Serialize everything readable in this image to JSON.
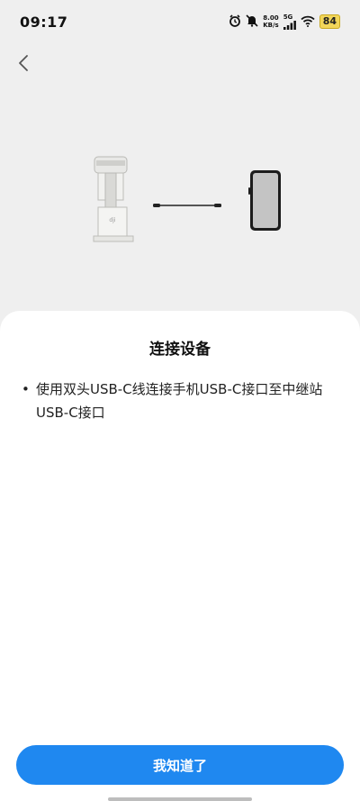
{
  "status": {
    "time": "09:17",
    "net_speed_value": "8.00",
    "net_speed_unit": "KB/s",
    "network_type": "5G",
    "battery": "84"
  },
  "sheet": {
    "title": "连接设备",
    "bullet_text": "使用双头USB-C线连接手机USB-C接口至中继站USB-C接口",
    "button_label": "我知道了"
  }
}
